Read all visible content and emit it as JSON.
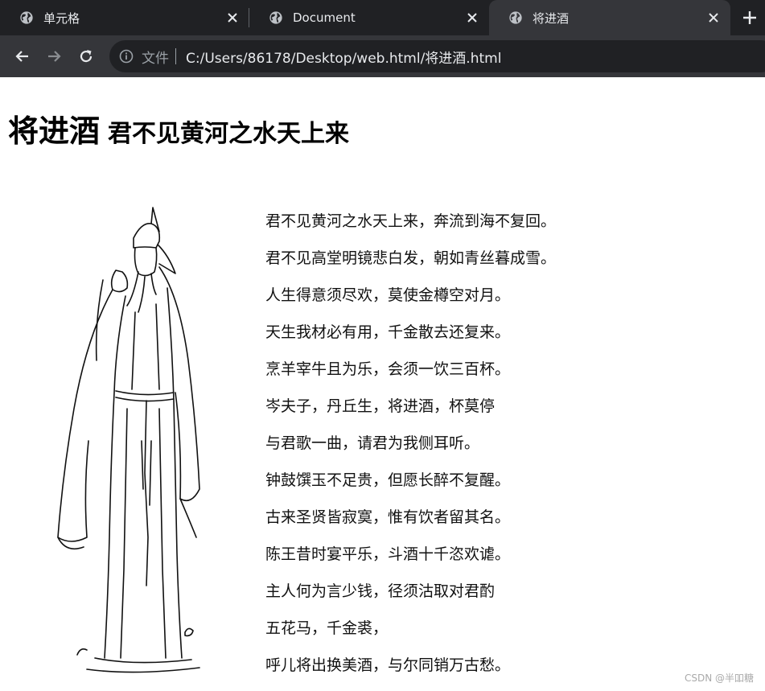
{
  "tabs": [
    {
      "title": "单元格",
      "active": false
    },
    {
      "title": "Document",
      "active": false
    },
    {
      "title": "将进酒",
      "active": true
    }
  ],
  "toolbar": {
    "scheme_label": "文件",
    "url": "C:/Users/86178/Desktop/web.html/将进酒.html"
  },
  "page": {
    "heading_main": "将进酒",
    "heading_sub": "君不见黄河之水天上来",
    "poem_lines": [
      "君不见黄河之水天上来，奔流到海不复回。",
      "君不见高堂明镜悲白发，朝如青丝暮成雪。",
      "人生得意须尽欢，莫使金樽空对月。",
      "天生我材必有用，千金散去还复来。",
      "烹羊宰牛且为乐，会须一饮三百杯。",
      "岑夫子，丹丘生，将进酒，杯莫停",
      "与君歌一曲，请君为我侧耳听。",
      "钟鼓馔玉不足贵，但愿长醉不复醒。",
      "古来圣贤皆寂寞，惟有饮者留其名。",
      "陈王昔时宴平乐，斗酒十千恣欢谑。",
      "主人何为言少钱，径须沽取对君酌",
      "五花马，千金裘，",
      "呼儿将出换美酒，与尔同销万古愁。"
    ],
    "watermark": "CSDN @半吅糖"
  },
  "colors": {
    "tabstrip_bg": "#202124",
    "active_tab_bg": "#35363a",
    "omnibox_bg": "#202124",
    "text_light": "#e8eaed"
  }
}
